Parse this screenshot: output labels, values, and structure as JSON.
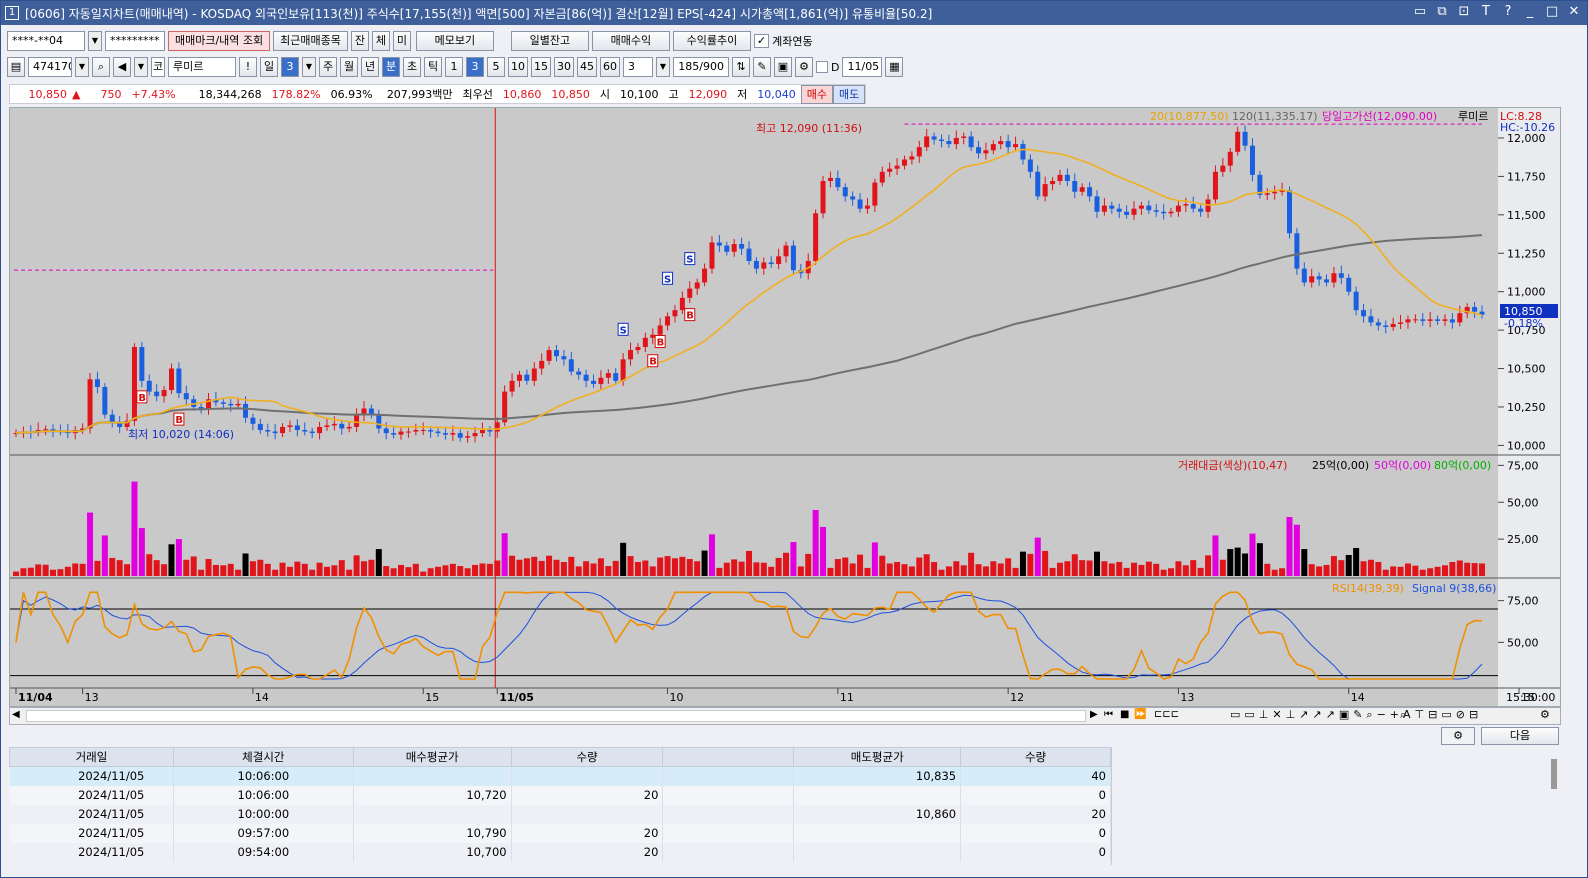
{
  "window": {
    "screen_no": "1",
    "title": "[0606] 자동일지차트(매매내역) - KOSDAQ 외국인보유[113(천)] 주식수[17,155(천)] 액면[500] 자본금[86(억)] 결산[12월] EPS[-424] 시가총액[1,861(억)] 유통비율[50.2]",
    "title_icons": [
      "window-icon",
      "copy-icon",
      "pin-icon",
      "font-icon",
      "help-icon",
      "minimize-icon",
      "maximize-icon",
      "close-icon"
    ]
  },
  "toolbar1": {
    "account": "****-**04",
    "password": "*********",
    "buttons": [
      "매매마크/내역 조회",
      "최근매매종목",
      "잔",
      "체",
      "미",
      "메모보기",
      "일별잔고",
      "매매수익",
      "수익률추이"
    ],
    "checkbox_label": "계좌연동",
    "checkbox_checked": true
  },
  "toolbar2": {
    "code": "474170",
    "market": "코",
    "name": "루미르",
    "period_buttons": [
      "일",
      "3",
      "주",
      "월",
      "년",
      "분",
      "초",
      "틱",
      "1",
      "3",
      "5",
      "10",
      "15",
      "30",
      "45",
      "60"
    ],
    "selected_period": "분",
    "selected_interval": "3",
    "interval_value": "3",
    "count": "185/900",
    "date_checkbox": "D",
    "date": "11/05"
  },
  "quote": {
    "price": "10,850",
    "change_arrow": "▲",
    "change": "750",
    "change_pct": "+7.43%",
    "volume": "18,344,268",
    "vol_ratio": "178.82%",
    "turnover": "06.93%",
    "amount": "207,993백만",
    "best_ask_label": "최우선",
    "ask": "10,860",
    "bid": "10,850",
    "open_label": "시",
    "open": "10,100",
    "high_label": "고",
    "high": "12,090",
    "low_label": "저",
    "low": "10,040",
    "buy_btn": "매수",
    "sell_btn": "매도"
  },
  "chart_data": {
    "type": "candlestick",
    "price_axis_ticks": [
      "12,000",
      "11,750",
      "11,500",
      "11,250",
      "11,000",
      "10,750",
      "10,500",
      "10,250",
      "10,000"
    ],
    "price_ylim": [
      9970,
      12130
    ],
    "legend": {
      "ma20": "20(10,877.50)",
      "ma120": "120(11,335.17)",
      "high_line": "당일고가선(12,090.00)",
      "stock": "루미르",
      "lc": "LC:8.28",
      "hc": "HC:-10.26"
    },
    "annotations": {
      "high": "최고 12,090 (11:36)",
      "low": "최저 10,020 (14:06)",
      "last_price": "10,850",
      "last_pct": "-0.18%"
    },
    "markers": [
      {
        "label": "B",
        "idx": 17
      },
      {
        "label": "B",
        "idx": 22
      },
      {
        "label": "S",
        "idx": 82
      },
      {
        "label": "B",
        "idx": 86
      },
      {
        "label": "B",
        "idx": 87
      },
      {
        "label": "S",
        "idx": 88
      },
      {
        "label": "S",
        "idx": 91
      },
      {
        "label": "B",
        "idx": 91
      }
    ],
    "time_labels": [
      {
        "label": "11/04",
        "idx": 0,
        "bold": true
      },
      {
        "label": "13",
        "idx": 9
      },
      {
        "label": "14",
        "idx": 32
      },
      {
        "label": "15",
        "idx": 55
      },
      {
        "label": "11/05",
        "idx": 65,
        "bold": true
      },
      {
        "label": "10",
        "idx": 88
      },
      {
        "label": "11",
        "idx": 111
      },
      {
        "label": "12",
        "idx": 134
      },
      {
        "label": "13",
        "idx": 157
      },
      {
        "label": "14",
        "idx": 180
      },
      {
        "label": "15",
        "idx": 203
      }
    ],
    "time_end_label": "15:30:00",
    "closes": [
      10080,
      10090,
      10085,
      10100,
      10105,
      10095,
      10090,
      10080,
      10100,
      10110,
      10430,
      10380,
      10200,
      10150,
      10120,
      10160,
      10640,
      10420,
      10350,
      10320,
      10360,
      10500,
      10340,
      10300,
      10250,
      10240,
      10300,
      10280,
      10270,
      10260,
      10270,
      10180,
      10140,
      10100,
      10090,
      10080,
      10120,
      10130,
      10100,
      10090,
      10080,
      10120,
      10130,
      10140,
      10110,
      10120,
      10200,
      10240,
      10200,
      10110,
      10080,
      10070,
      10090,
      10090,
      10100,
      10100,
      10090,
      10080,
      10070,
      10080,
      10050,
      10060,
      10080,
      10100,
      10090,
      10150,
      10350,
      10420,
      10460,
      10420,
      10500,
      10550,
      10620,
      10580,
      10560,
      10480,
      10460,
      10420,
      10400,
      10440,
      10470,
      10420,
      10560,
      10620,
      10640,
      10700,
      10720,
      10780,
      10840,
      10880,
      10960,
      11020,
      11060,
      11150,
      11320,
      11300,
      11260,
      11310,
      11280,
      11200,
      11150,
      11190,
      11180,
      11230,
      11300,
      11140,
      11120,
      11200,
      11510,
      11720,
      11740,
      11680,
      11620,
      11600,
      11540,
      11560,
      11710,
      11780,
      11800,
      11820,
      11860,
      11880,
      11940,
      12010,
      11990,
      11980,
      11960,
      12000,
      12010,
      11940,
      11900,
      11920,
      11960,
      11980,
      11940,
      11960,
      11860,
      11780,
      11620,
      11700,
      11720,
      11760,
      11720,
      11650,
      11680,
      11620,
      11520,
      11560,
      11540,
      11520,
      11500,
      11540,
      11560,
      11530,
      11520,
      11510,
      11520,
      11560,
      11570,
      11540,
      11520,
      11600,
      11780,
      11820,
      11910,
      12040,
      11950,
      11760,
      11630,
      11640,
      11650,
      11660,
      11380,
      11150,
      11060,
      11100,
      11080,
      11060,
      11120,
      11090,
      11000,
      10880,
      10840,
      10800,
      10780,
      10770,
      10790,
      10800,
      10820,
      10820,
      10810,
      10820,
      10810,
      10820,
      10800,
      10860,
      10900,
      10870,
      10850
    ],
    "volume_axis_ticks": [
      "75,00",
      "50,00",
      "25,00"
    ],
    "volume_legend": {
      "title": "거래대금(색상)(10,47)",
      "l25": "25억(0,00)",
      "l50": "50억(0,00)",
      "l80": "80억(0,00)"
    },
    "rsi_axis_ticks": [
      "75,00",
      "50,00"
    ],
    "rsi_legend": {
      "rsi": "RSI14(39,39)",
      "signal": "Signal 9(38,66)"
    }
  },
  "tabbar_icons": [
    "next-icon",
    "prev-page-icon",
    "stop-icon",
    "fast-forward-icon",
    "ruler-icon",
    "minus-icon",
    "plus-icon",
    "zoom-icon",
    "settings-icon"
  ],
  "grid": {
    "headers": [
      "거래일",
      "체결시간",
      "매수평균가",
      "수량",
      "",
      "매도평균가",
      "수량"
    ],
    "rows": [
      [
        "2024/11/05",
        "10:06:00",
        "",
        "",
        "",
        "10,835",
        "40"
      ],
      [
        "2024/11/05",
        "10:06:00",
        "10,720",
        "20",
        "",
        "",
        "0"
      ],
      [
        "2024/11/05",
        "10:00:00",
        "",
        "",
        "",
        "10,860",
        "20"
      ],
      [
        "2024/11/05",
        "09:57:00",
        "10,790",
        "20",
        "",
        "",
        "0"
      ],
      [
        "2024/11/05",
        "09:54:00",
        "10,700",
        "20",
        "",
        "",
        "0"
      ]
    ],
    "next_btn": "다음"
  }
}
